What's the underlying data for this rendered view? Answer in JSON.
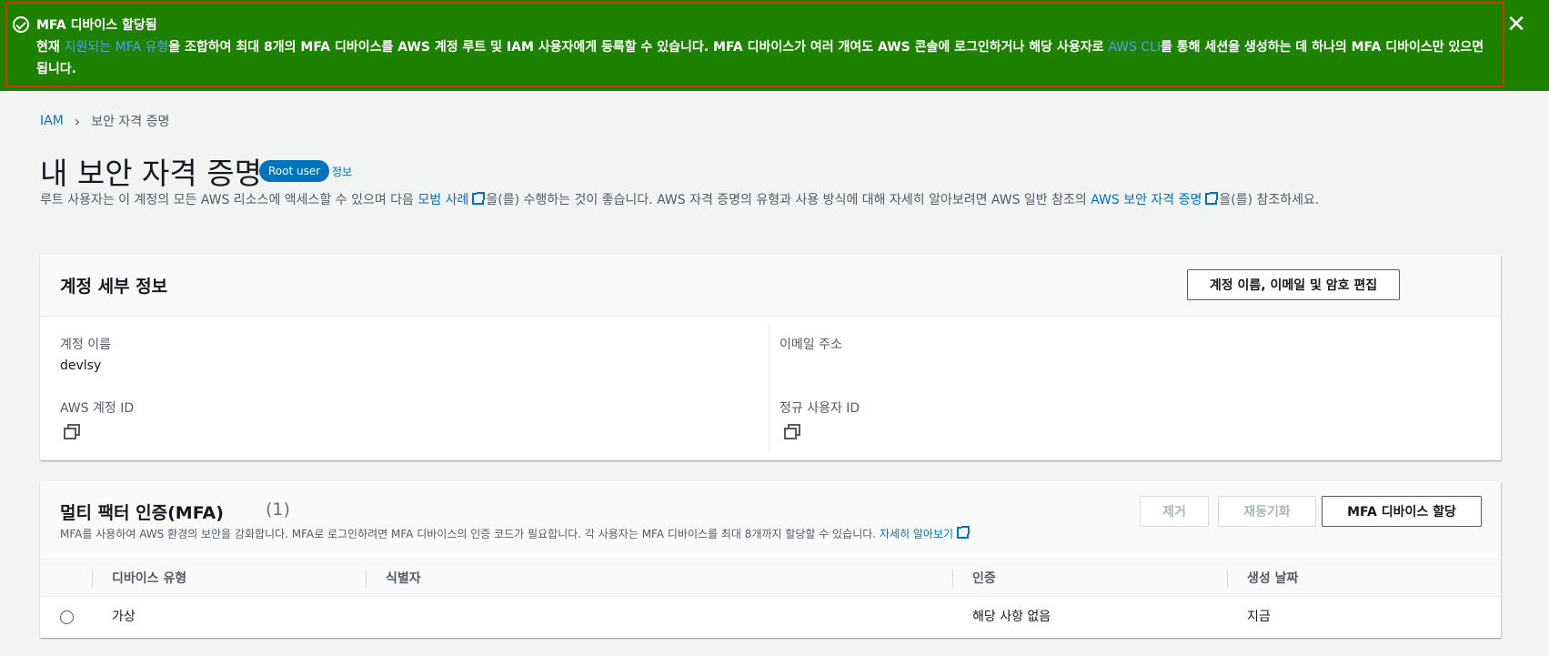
{
  "banner": {
    "title": "MFA 디바이스 할당됨",
    "body_prefix": "현재 ",
    "link_supported": "지원되는 MFA 유형",
    "body_mid": "을 조합하여 최대 8개의 MFA 디바이스를 AWS 계정 루트 및 IAM 사용자에게 등록할 수 있습니다. MFA 디바이스가 여러 개여도 AWS 콘솔에 로그인하거나 해당 사용자로 ",
    "link_cli": "AWS CLI",
    "body_suffix": "를 통해 세션을 생성하는 데 하나의 MFA 디바이스만 있으면 됩니다.",
    "close_glyph": "✕",
    "bg_color": "#1d8102"
  },
  "breadcrumb": {
    "root": "IAM",
    "current": "보안 자격 증명"
  },
  "page": {
    "title": "내 보안 자격 증명",
    "badge": "Root user",
    "info_link": "정보",
    "desc_1": "루트 사용자는 이 계정의 모든 AWS 리소스에 액세스할 수 있으며 다음 ",
    "desc_link_1": "모범 사례",
    "desc_2": "을(를) 수행하는 것이 좋습니다. AWS 자격 증명의 유형과 사용 방식에 대해 자세히 알아보려면 AWS 일반 참조의 ",
    "desc_link_2": "AWS 보안 자격 증명",
    "desc_3": "을(를) 참조하세요."
  },
  "account": {
    "title": "계정 세부 정보",
    "edit_button": "계정 이름, 이메일 및 암호 편집",
    "name_label": "계정 이름",
    "name_value": "devlsy",
    "email_label": "이메일 주소",
    "account_id_label": "AWS 계정 ID",
    "canonical_id_label": "정규 사용자 ID"
  },
  "mfa": {
    "title": "멀티 팩터 인증(MFA)",
    "count": "(1)",
    "desc": "MFA를 사용하여 AWS 환경의 보안을 강화합니다. MFA로 로그인하려면 MFA 디바이스의 인증 코드가 필요합니다. 각 사용자는 MFA 디바이스를 최대 8개까지 할당할 수 있습니다. ",
    "learn_more": "자세히 알아보기",
    "remove_button": "제거",
    "resync_button": "재동기화",
    "assign_button": "MFA 디바이스 할당",
    "columns": [
      "디바이스 유형",
      "식별자",
      "인증",
      "생성 날짜"
    ],
    "rows": [
      {
        "type": "가상",
        "identifier": "",
        "certification": "해당 사항 없음",
        "created": "지금"
      }
    ]
  },
  "icons": [
    "check-circle-icon",
    "close-icon",
    "chevron-right-icon",
    "external-link-icon",
    "copy-icon"
  ]
}
